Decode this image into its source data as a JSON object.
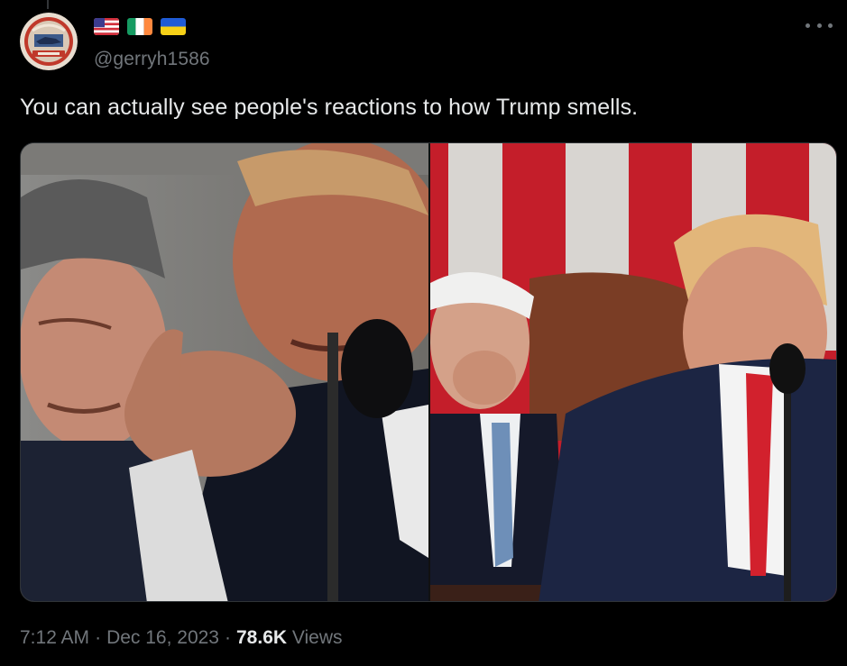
{
  "author": {
    "handle": "@gerryh1586",
    "avatar": "vintage postage stamp avatar",
    "flags": [
      "us-flag-icon",
      "ireland-flag-icon",
      "ukraine-flag-icon"
    ]
  },
  "tweet": {
    "text": "You can actually see people's reactions to how Trump smells."
  },
  "media": {
    "images": [
      {
        "name": "left-photo"
      },
      {
        "name": "right-photo"
      }
    ]
  },
  "meta": {
    "time": "7:12 AM",
    "separator": "·",
    "date": "Dec 16, 2023",
    "views_count": "78.6K",
    "views_label": "Views"
  },
  "colors": {
    "background": "#000000",
    "text_primary": "#e7e9ea",
    "text_secondary": "#71767b",
    "border": "#2f3336"
  }
}
